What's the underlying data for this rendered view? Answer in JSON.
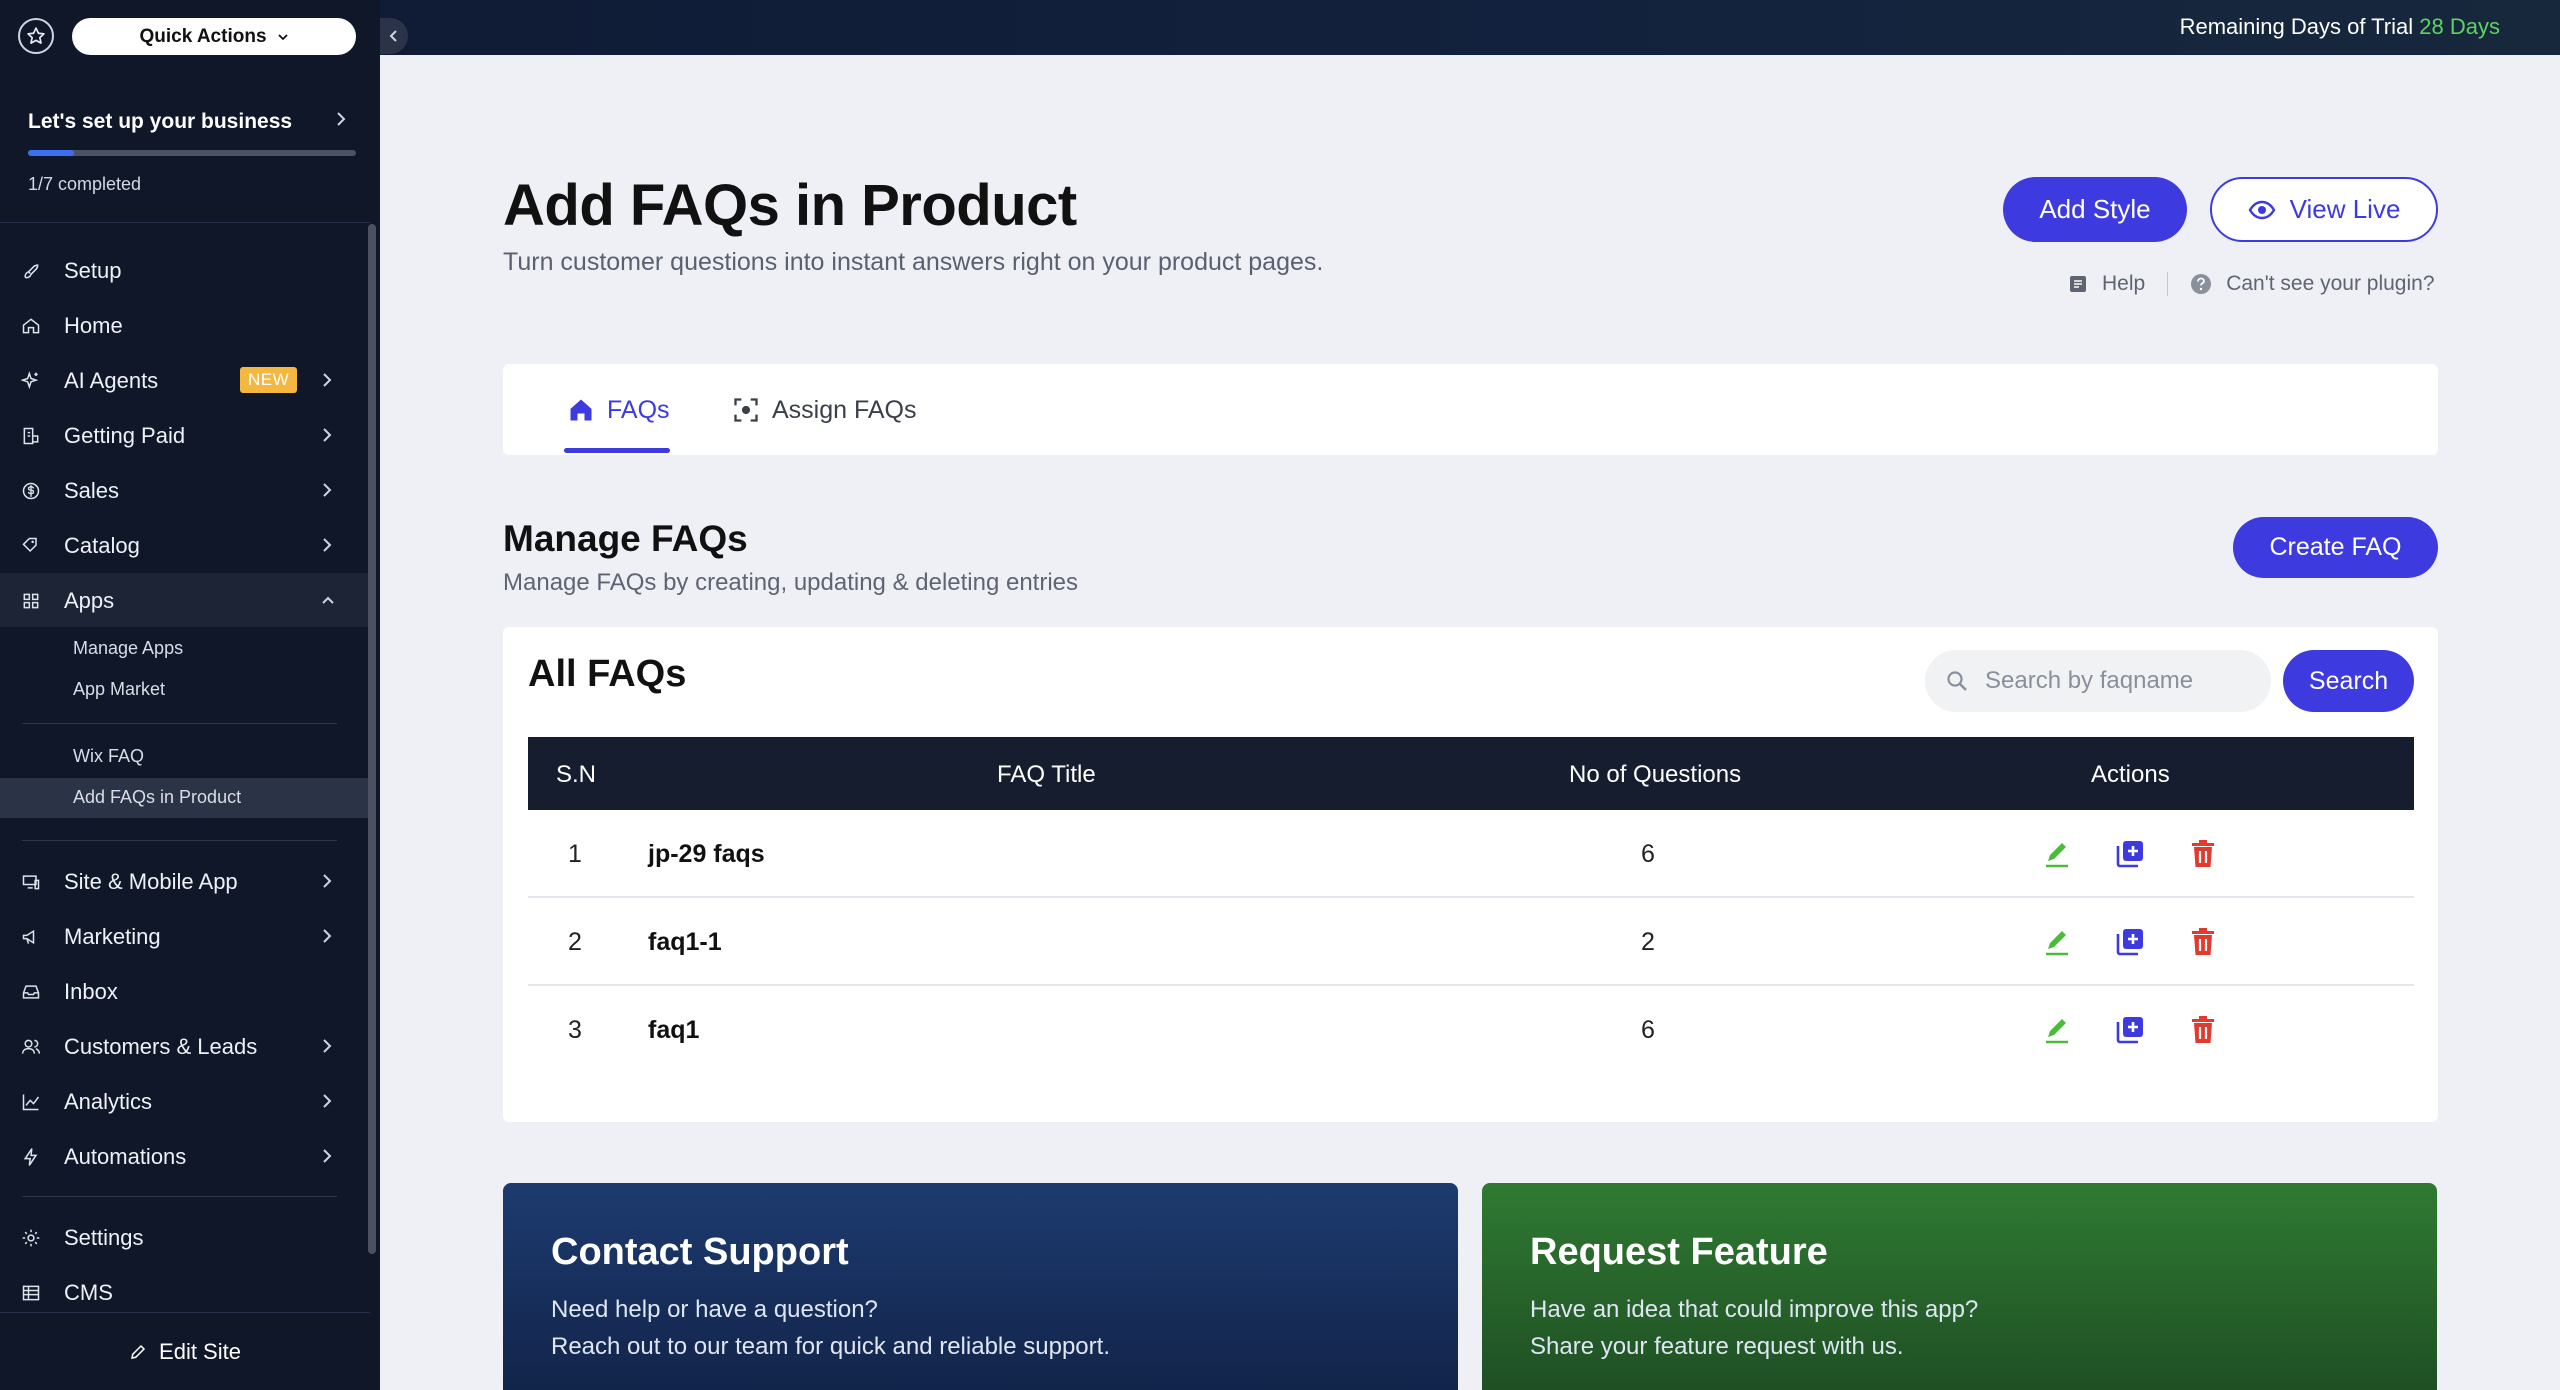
{
  "topbar": {
    "trial_label": "Remaining Days of Trial",
    "trial_days": "28 Days"
  },
  "sidebar": {
    "quick_actions": "Quick Actions",
    "setup": {
      "title": "Let's set up your business",
      "progress_text": "1/7 completed",
      "progress_fraction": 0.14
    },
    "items": [
      {
        "label": "Setup",
        "icon": "rocket-icon"
      },
      {
        "label": "Home",
        "icon": "home-icon"
      },
      {
        "label": "AI Agents",
        "icon": "sparkle-icon",
        "badge": "NEW"
      },
      {
        "label": "Getting Paid",
        "icon": "payment-icon"
      },
      {
        "label": "Sales",
        "icon": "dollar-icon"
      },
      {
        "label": "Catalog",
        "icon": "tag-icon"
      },
      {
        "label": "Apps",
        "icon": "apps-icon"
      },
      {
        "label": "Site & Mobile App",
        "icon": "devices-icon"
      },
      {
        "label": "Marketing",
        "icon": "megaphone-icon"
      },
      {
        "label": "Inbox",
        "icon": "inbox-icon"
      },
      {
        "label": "Customers & Leads",
        "icon": "people-icon"
      },
      {
        "label": "Analytics",
        "icon": "chart-icon"
      },
      {
        "label": "Automations",
        "icon": "bolt-icon"
      },
      {
        "label": "Settings",
        "icon": "gear-icon"
      },
      {
        "label": "CMS",
        "icon": "table-icon"
      }
    ],
    "apps_sub": [
      "Manage Apps",
      "App Market",
      "Wix FAQ",
      "Add FAQs in Product"
    ],
    "edit_site": "Edit Site"
  },
  "header": {
    "title": "Add FAQs in Product",
    "subtitle": "Turn customer questions into instant answers right on your product pages.",
    "add_style": "Add Style",
    "view_live": "View Live",
    "help": "Help",
    "cant_see": "Can't see your plugin?"
  },
  "tabs": [
    {
      "label": "FAQs",
      "active": true
    },
    {
      "label": "Assign FAQs",
      "active": false
    }
  ],
  "manage": {
    "title": "Manage FAQs",
    "subtitle": "Manage FAQs by creating, updating & deleting entries",
    "create_button": "Create FAQ"
  },
  "table": {
    "title": "All FAQs",
    "search_placeholder": "Search by faqname",
    "search_button": "Search",
    "columns": [
      "S.N",
      "FAQ Title",
      "No of Questions",
      "Actions"
    ],
    "rows": [
      {
        "sn": "1",
        "title": "jp-29 faqs",
        "questions": "6"
      },
      {
        "sn": "2",
        "title": "faq1-1",
        "questions": "2"
      },
      {
        "sn": "3",
        "title": "faq1",
        "questions": "6"
      }
    ]
  },
  "promos": {
    "support": {
      "title": "Contact Support",
      "line1": "Need help or have a question?",
      "line2": "Reach out to our team for quick and reliable support."
    },
    "feature": {
      "title": "Request Feature",
      "line1": "Have an idea that could improve this app?",
      "line2": "Share your feature request with us."
    }
  },
  "colors": {
    "accent": "#3d3be0",
    "sidebar_bg": "#0f1729",
    "edit_green": "#4cbb3c",
    "delete_red": "#e03b2e",
    "trial_green": "#5fd35f"
  }
}
